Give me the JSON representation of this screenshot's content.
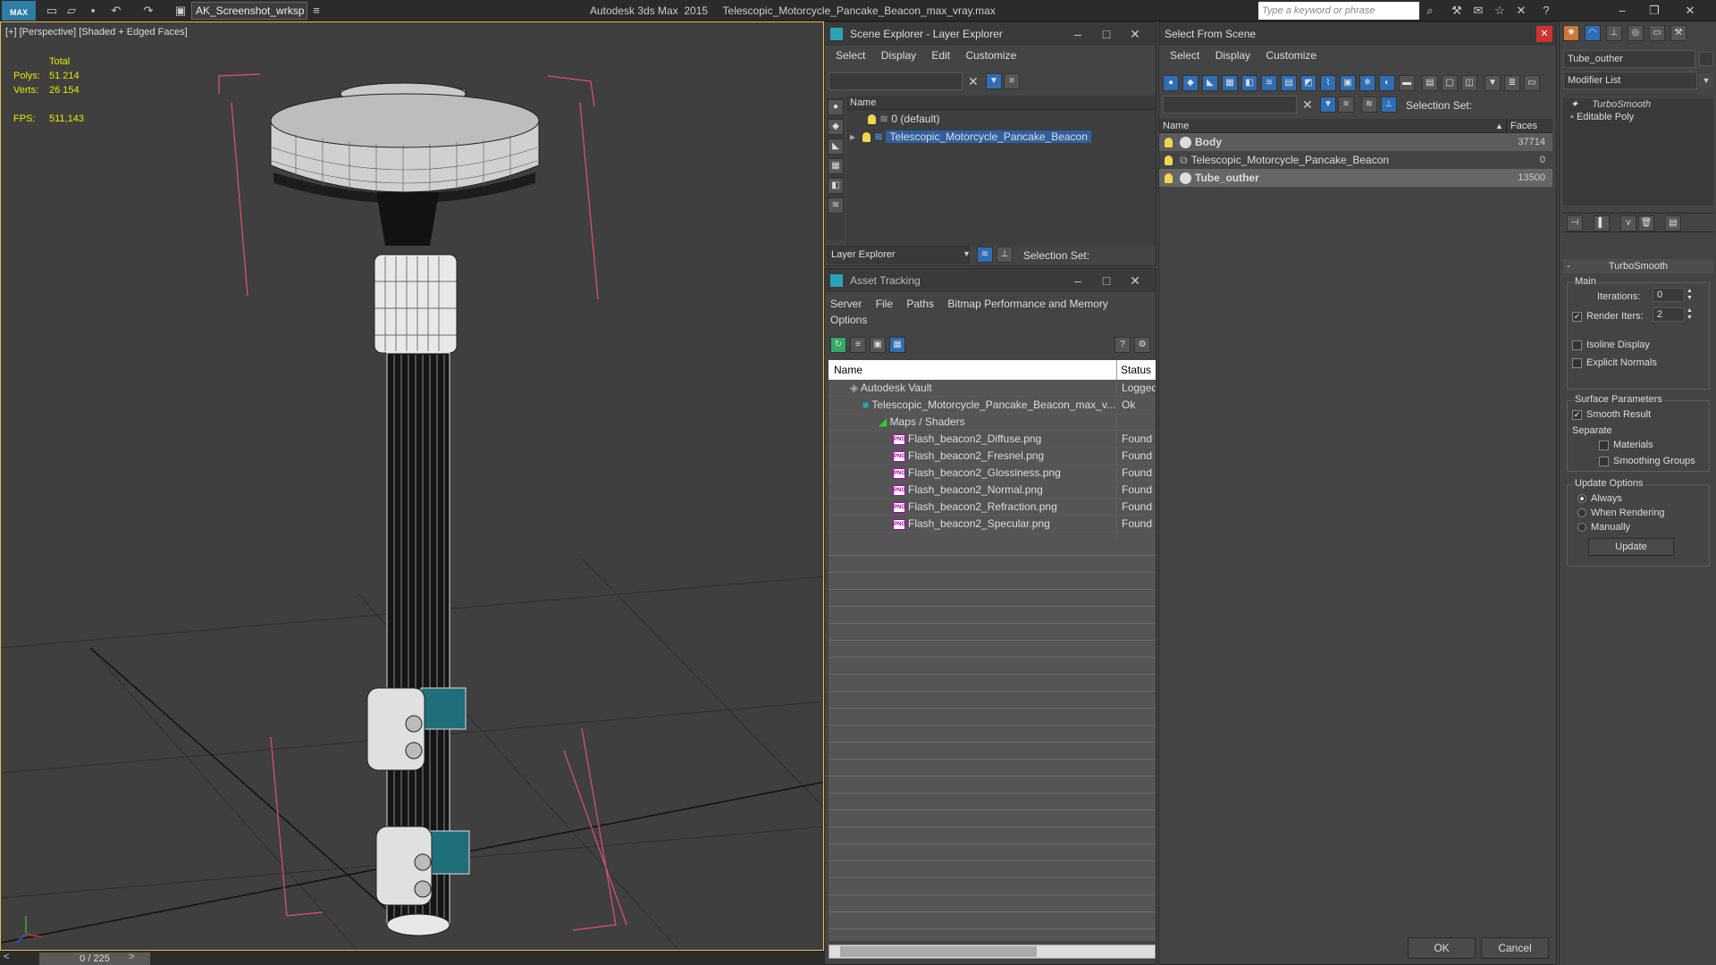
{
  "app": {
    "logo": "MAX",
    "workspace": "AK_Screenshot_wrksp",
    "title": "Autodesk 3ds Max  2015     Telescopic_Motorcycle_Pancake_Beacon_max_vray.max",
    "search_placeholder": "Type a keyword or phrase"
  },
  "viewport": {
    "label": "[+] [Perspective] [Shaded + Edged Faces]",
    "stats": {
      "total_label": "Total",
      "polys_label": "Polys:",
      "polys": "51 214",
      "verts_label": "Verts:",
      "verts": "26 154",
      "fps_label": "FPS:",
      "fps": "511,143"
    },
    "frame": "0 / 225",
    "colors": {
      "frame": "#e6c04b",
      "bbox": "#e0507a",
      "teal": "#1f6f7a"
    }
  },
  "scene_explorer": {
    "title": "Scene Explorer - Layer Explorer",
    "menu": [
      "Select",
      "Display",
      "Edit",
      "Customize"
    ],
    "column": "Name",
    "rows": [
      "0 (default)",
      "Telescopic_Motorcycle_Pancake_Beacon"
    ],
    "footer_dropdown": "Layer Explorer",
    "selection_set": "Selection Set:"
  },
  "asset_tracking": {
    "title": "Asset Tracking",
    "menu": [
      "Server",
      "File",
      "Paths",
      "Bitmap Performance and Memory"
    ],
    "menu2": "Options",
    "columns": [
      "Name",
      "Status"
    ],
    "rows": [
      {
        "name": "Autodesk Vault",
        "status": "Logged"
      },
      {
        "name": "Telescopic_Motorcycle_Pancake_Beacon_max_v...",
        "status": "Ok"
      },
      {
        "name": "Maps / Shaders",
        "status": ""
      },
      {
        "name": "Flash_beacon2_Diffuse.png",
        "status": "Found"
      },
      {
        "name": "Flash_beacon2_Fresnel.png",
        "status": "Found"
      },
      {
        "name": "Flash_beacon2_Glossiness.png",
        "status": "Found"
      },
      {
        "name": "Flash_beacon2_Normal.png",
        "status": "Found"
      },
      {
        "name": "Flash_beacon2_Refraction.png",
        "status": "Found"
      },
      {
        "name": "Flash_beacon2_Specular.png",
        "status": "Found"
      }
    ]
  },
  "select_from_scene": {
    "title": "Select From Scene",
    "menu": [
      "Select",
      "Display",
      "Customize"
    ],
    "selection_set": "Selection Set:",
    "columns": [
      "Name",
      "Faces"
    ],
    "rows": [
      {
        "name": "Body",
        "faces": "37714"
      },
      {
        "name": "Telescopic_Motorcycle_Pancake_Beacon",
        "faces": "0"
      },
      {
        "name": "Tube_outher",
        "faces": "13500"
      }
    ],
    "ok": "OK",
    "cancel": "Cancel"
  },
  "command_panel": {
    "object_name": "Tube_outher",
    "modifier_list": "Modifier List",
    "stack": [
      "TurboSmooth",
      "Editable Poly"
    ],
    "rollout": "TurboSmooth",
    "main_label": "Main",
    "iterations_label": "Iterations:",
    "iterations": "0",
    "render_iters_label": "Render Iters:",
    "render_iters": "2",
    "isoline": "Isoline Display",
    "explicit_normals": "Explicit Normals",
    "surface_params": "Surface Parameters",
    "smooth_result": "Smooth Result",
    "separate": "Separate",
    "materials": "Materials",
    "smoothing_groups": "Smoothing Groups",
    "update_options": "Update Options",
    "always": "Always",
    "when_rendering": "When Rendering",
    "manually": "Manually",
    "update": "Update"
  }
}
